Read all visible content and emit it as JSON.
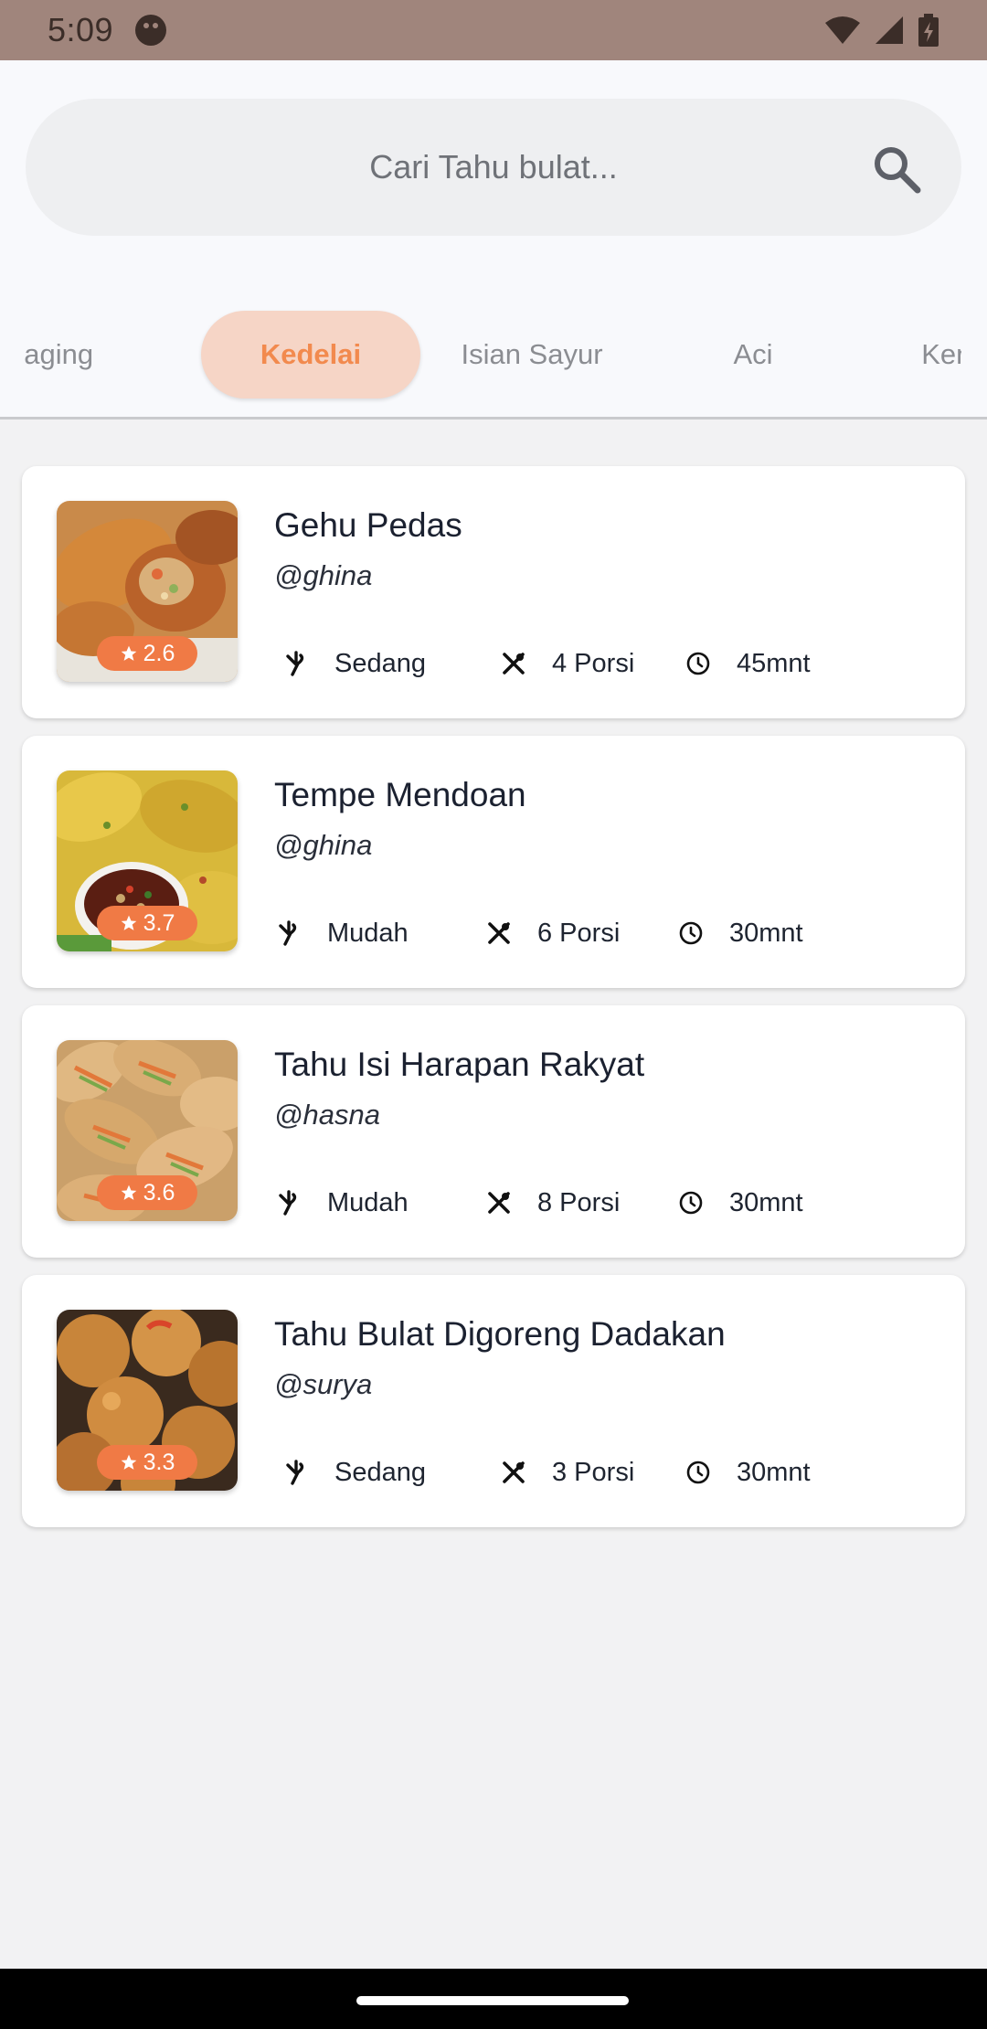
{
  "status_bar": {
    "time": "5:09"
  },
  "search": {
    "placeholder": "Cari Tahu bulat..."
  },
  "tabs": [
    {
      "label": "Isian Daging",
      "active": false
    },
    {
      "label": "Kedelai",
      "active": true
    },
    {
      "label": "Isian Sayur",
      "active": false
    },
    {
      "label": "Aci",
      "active": false
    },
    {
      "label": "Kentang",
      "active": false
    }
  ],
  "colors": {
    "accent": "#f28a4e",
    "tab_active_bg": "#f6d5c6",
    "rating_badge": "#f07a45",
    "status_bar": "#a0857c"
  },
  "recipes": [
    {
      "title": "Gehu Pedas",
      "author": "@ghina",
      "rating": "2.6",
      "difficulty": "Sedang",
      "portions": "4 Porsi",
      "time": "45mnt"
    },
    {
      "title": "Tempe Mendoan",
      "author": "@ghina",
      "rating": "3.7",
      "difficulty": "Mudah",
      "portions": "6 Porsi",
      "time": "30mnt"
    },
    {
      "title": "Tahu Isi Harapan Rakyat",
      "author": "@hasna",
      "rating": "3.6",
      "difficulty": "Mudah",
      "portions": "8 Porsi",
      "time": "30mnt"
    },
    {
      "title": "Tahu Bulat Digoreng Dadakan",
      "author": "@surya",
      "rating": "3.3",
      "difficulty": "Sedang",
      "portions": "3 Porsi",
      "time": "30mnt"
    }
  ],
  "icons": {
    "difficulty": "chef-hat-icon",
    "portions": "utensils-crossed-icon",
    "time": "clock-icon",
    "rating": "star-icon",
    "search": "search-icon"
  }
}
